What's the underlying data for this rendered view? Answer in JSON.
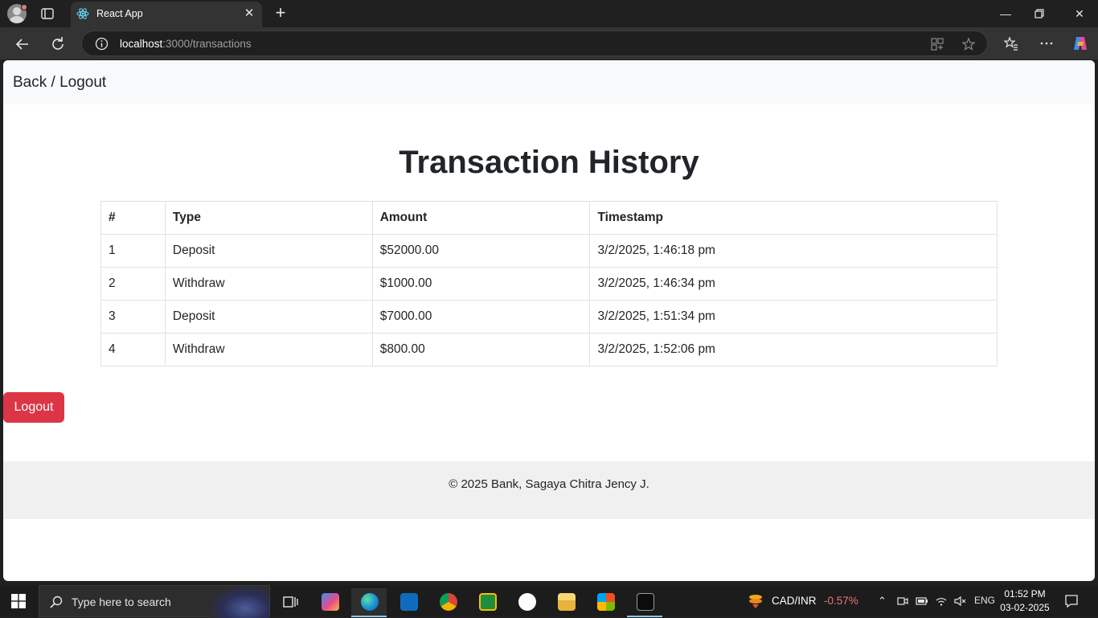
{
  "browser": {
    "tab_title": "React App",
    "url_host": "localhost",
    "url_path": ":3000/transactions"
  },
  "app": {
    "nav_link": "Back / Logout",
    "page_title": "Transaction History",
    "table": {
      "headers": [
        "#",
        "Type",
        "Amount",
        "Timestamp"
      ],
      "rows": [
        [
          "1",
          "Deposit",
          "$52000.00",
          "3/2/2025, 1:46:18 pm"
        ],
        [
          "2",
          "Withdraw",
          "$1000.00",
          "3/2/2025, 1:46:34 pm"
        ],
        [
          "3",
          "Deposit",
          "$7000.00",
          "3/2/2025, 1:51:34 pm"
        ],
        [
          "4",
          "Withdraw",
          "$800.00",
          "3/2/2025, 1:52:06 pm"
        ]
      ]
    },
    "logout_button": "Logout",
    "footer": "© 2025 Bank, Sagaya Chitra Jency J."
  },
  "taskbar": {
    "search_placeholder": "Type here to search",
    "ticker_label": "CAD/INR",
    "ticker_change": "-0.57%",
    "language": "ENG",
    "time": "01:52 PM",
    "date": "03-02-2025"
  },
  "colors": {
    "danger": "#dc3545",
    "ticker_negative": "#f1707b"
  }
}
